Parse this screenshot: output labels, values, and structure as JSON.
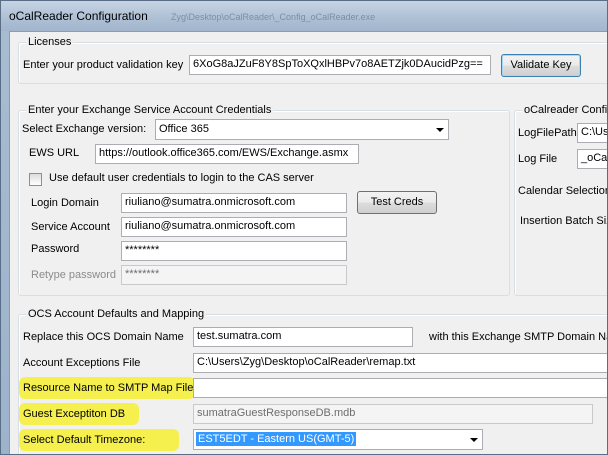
{
  "window": {
    "title": "oCalReader Configuration",
    "behind_title": "Zyg\\Desktop\\oCalReader\\_Config_oCalReader.exe"
  },
  "licenses": {
    "group_label": "Licenses",
    "key_label": "Enter your product validation key",
    "key_value": "6XoG8aJZuF8Y8SpToXQxlHBPv7o8AETZjk0DAucidPzg==",
    "validate_button": "Validate Key"
  },
  "exchange": {
    "group_label": "Enter your Exchange Service Account Credentials",
    "version_label": "Select Exchange version:",
    "version_value": "Office 365",
    "ews_label": "EWS URL",
    "ews_value": "https://outlook.office365.com/EWS/Exchange.asmx",
    "default_creds_label": "Use default user credentials to login to the CAS server",
    "default_creds_checked": false,
    "login_domain_label": "Login Domain",
    "login_domain_value": "riuliano@sumatra.onmicrosoft.com",
    "test_creds_button": "Test Creds",
    "service_account_label": "Service Account",
    "service_account_value": "riuliano@sumatra.onmicrosoft.com",
    "password_label": "Password",
    "password_value": "********",
    "retype_label": "Retype password",
    "retype_value": "********"
  },
  "ocalreader": {
    "group_label": "oCalreader Configu",
    "logfilepath_label": "LogFilePath",
    "logfilepath_value": "C:\\Us",
    "logfile_label": "Log File",
    "logfile_value": "_oCa",
    "calendar_selection_label": "Calendar Selection",
    "insertion_batch_label": "Insertion Batch Siz"
  },
  "ocs": {
    "group_label": "OCS Account Defaults and Mapping",
    "replace_label": "Replace this OCS Domain Name",
    "replace_value": "test.sumatra.com",
    "smtp_domain_label": "with this Exchange SMTP Domain Nam",
    "exceptions_label": "Account Exceptions File",
    "exceptions_value": "C:\\Users\\Zyg\\Desktop\\oCalReader\\remap.txt",
    "resource_map_label": "Resource Name to SMTP Map File",
    "resource_map_value": "",
    "guest_db_label": "Guest Exceptiton DB",
    "guest_db_value": "sumatraGuestResponseDB.mdb",
    "timezone_label": "Select Default Timezone:",
    "timezone_value": "EST5EDT - Eastern US(GMT-5)"
  },
  "colors": {
    "highlight": "#f5f03c",
    "selection": "#3399ff"
  }
}
